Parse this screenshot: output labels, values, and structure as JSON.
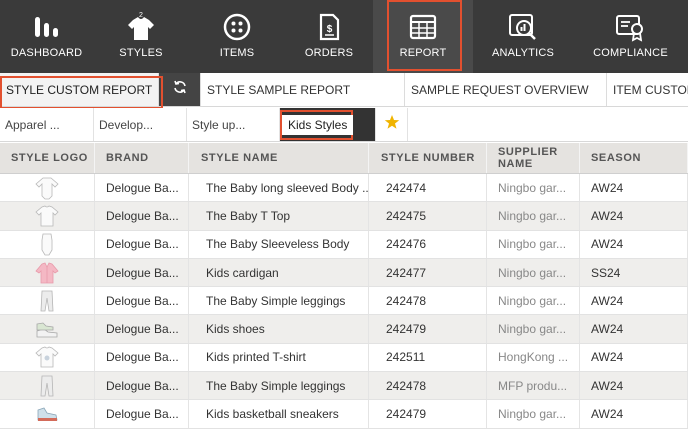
{
  "nav": {
    "items": [
      {
        "label": "DASHBOARD",
        "icon": "dashboard-icon"
      },
      {
        "label": "STYLES",
        "icon": "shirt-icon"
      },
      {
        "label": "ITEMS",
        "icon": "button-icon"
      },
      {
        "label": "ORDERS",
        "icon": "orders-icon"
      },
      {
        "label": "REPORT",
        "icon": "report-grid-icon"
      },
      {
        "label": "ANALYTICS",
        "icon": "analytics-icon"
      },
      {
        "label": "COMPLIANCE",
        "icon": "compliance-icon"
      }
    ],
    "active": "REPORT",
    "colors": {
      "background": "#3a3a3a",
      "highlight": "#e2502f"
    }
  },
  "report_tabs": {
    "items": [
      {
        "label": "STYLE CUSTOM REPORT"
      },
      {
        "label": "STYLE SAMPLE REPORT"
      },
      {
        "label": "SAMPLE REQUEST OVERVIEW"
      },
      {
        "label": "ITEM CUSTOM"
      }
    ],
    "active": "STYLE CUSTOM REPORT",
    "refresh_icon": "refresh-icon"
  },
  "filters": {
    "items": [
      {
        "label": "Apparel ..."
      },
      {
        "label": "Develop..."
      },
      {
        "label": "Style up..."
      },
      {
        "label": "Kids Styles"
      }
    ],
    "active": "Kids Styles",
    "favorite_icon": "star-icon",
    "star_color": "#f0b400"
  },
  "table": {
    "headers": {
      "logo": "STYLE LOGO",
      "brand": "BRAND",
      "name": "STYLE NAME",
      "number": "STYLE NUMBER",
      "supplier": "SUPPLIER NAME",
      "season": "SEASON"
    },
    "rows": [
      {
        "thumb": "bodysuit-longsleeve",
        "brand": "Delogue Ba...",
        "name": "The Baby long sleeved Body ...",
        "number": "242474",
        "supplier": "Ningbo gar...",
        "season": "AW24"
      },
      {
        "thumb": "tshirt",
        "brand": "Delogue Ba...",
        "name": "The Baby T Top",
        "number": "242475",
        "supplier": "Ningbo gar...",
        "season": "AW24"
      },
      {
        "thumb": "bodysuit",
        "brand": "Delogue Ba...",
        "name": "The Baby Sleeveless Body",
        "number": "242476",
        "supplier": "Ningbo gar...",
        "season": "AW24"
      },
      {
        "thumb": "cardigan",
        "brand": "Delogue Ba...",
        "name": "Kids cardigan",
        "number": "242477",
        "supplier": "Ningbo gar...",
        "season": "SS24"
      },
      {
        "thumb": "leggings",
        "brand": "Delogue Ba...",
        "name": "The Baby Simple leggings",
        "number": "242478",
        "supplier": "Ningbo gar...",
        "season": "AW24"
      },
      {
        "thumb": "shoes",
        "brand": "Delogue Ba...",
        "name": "Kids shoes",
        "number": "242479",
        "supplier": "Ningbo gar...",
        "season": "AW24"
      },
      {
        "thumb": "tshirt-printed",
        "brand": "Delogue Ba...",
        "name": "Kids printed T-shirt",
        "number": "242511",
        "supplier": "HongKong ...",
        "season": "AW24"
      },
      {
        "thumb": "leggings",
        "brand": "Delogue Ba...",
        "name": "The Baby Simple leggings",
        "number": "242478",
        "supplier": "MFP produ...",
        "season": "AW24"
      },
      {
        "thumb": "sneakers",
        "brand": "Delogue Ba...",
        "name": "Kids basketball sneakers",
        "number": "242479",
        "supplier": "Ningbo gar...",
        "season": "AW24"
      }
    ]
  }
}
